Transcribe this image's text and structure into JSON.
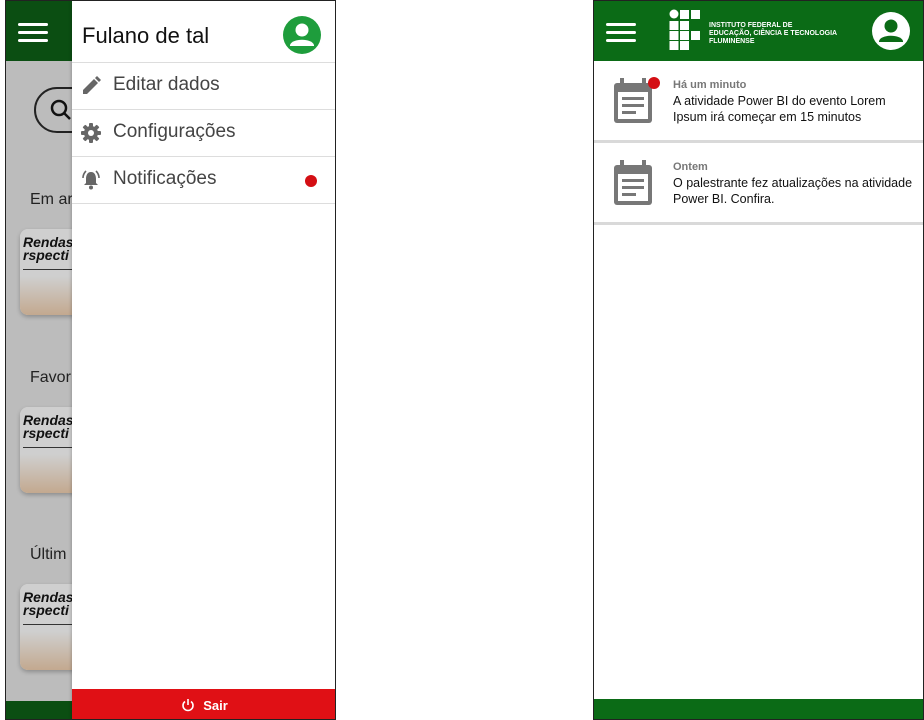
{
  "left_screen": {
    "drawer": {
      "user_name": "Fulano de tal",
      "menu": [
        {
          "label": "Editar dados",
          "icon": "pencil-icon"
        },
        {
          "label": "Configurações",
          "icon": "gear-icon"
        },
        {
          "label": "Notificações",
          "icon": "bell-ringing-icon",
          "has_badge": true
        }
      ],
      "logout_label": "Sair"
    },
    "background": {
      "sections": [
        "Em ar",
        "Favor",
        "Últim"
      ],
      "card_title_line1": "Rendas",
      "card_title_line2": "rspecti"
    }
  },
  "right_screen": {
    "logo_text": [
      "INSTITUTO FEDERAL DE",
      "EDUCAÇÃO, CIÊNCIA E TECNOLOGIA",
      "FLUMINENSE"
    ],
    "notifications": [
      {
        "time": "Há um minuto",
        "text": "A atividade Power BI do evento Lorem Ipsum irá começar em 15 minutos",
        "unread": true
      },
      {
        "time": "Ontem",
        "text": "O palestrante fez atualizações na atividade Power BI. Confira.",
        "unread": false
      }
    ]
  },
  "colors": {
    "header_green": "#0b6b16",
    "avatar_green": "#1e9d3c",
    "logout_red": "#e01015",
    "badge_red": "#d40f14"
  }
}
